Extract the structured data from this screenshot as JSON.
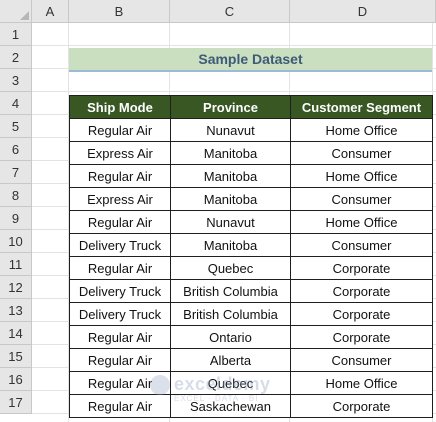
{
  "columns": [
    "A",
    "B",
    "C",
    "D"
  ],
  "rows": [
    "1",
    "2",
    "3",
    "4",
    "5",
    "6",
    "7",
    "8",
    "9",
    "10",
    "11",
    "12",
    "13",
    "14",
    "15",
    "16",
    "17"
  ],
  "title": "Sample Dataset",
  "headers": [
    "Ship Mode",
    "Province",
    "Customer Segment"
  ],
  "records": [
    [
      "Regular Air",
      "Nunavut",
      "Home Office"
    ],
    [
      "Express Air",
      "Manitoba",
      "Consumer"
    ],
    [
      "Regular Air",
      "Manitoba",
      "Home Office"
    ],
    [
      "Express Air",
      "Manitoba",
      "Consumer"
    ],
    [
      "Regular Air",
      "Nunavut",
      "Home Office"
    ],
    [
      "Delivery Truck",
      "Manitoba",
      "Consumer"
    ],
    [
      "Regular Air",
      "Quebec",
      "Corporate"
    ],
    [
      "Delivery Truck",
      "British Columbia",
      "Corporate"
    ],
    [
      "Delivery Truck",
      "British Columbia",
      "Corporate"
    ],
    [
      "Regular Air",
      "Ontario",
      "Corporate"
    ],
    [
      "Regular Air",
      "Alberta",
      "Consumer"
    ],
    [
      "Regular Air",
      "Quebec",
      "Home Office"
    ],
    [
      "Regular Air",
      "Saskachewan",
      "Corporate"
    ]
  ],
  "watermark": {
    "main": "exceldemy",
    "sub": "EXCEL · DATA · BI"
  },
  "colors": {
    "header_bg": "#385723",
    "title_bg": "#c9dfc0",
    "title_text": "#3e5a78"
  }
}
